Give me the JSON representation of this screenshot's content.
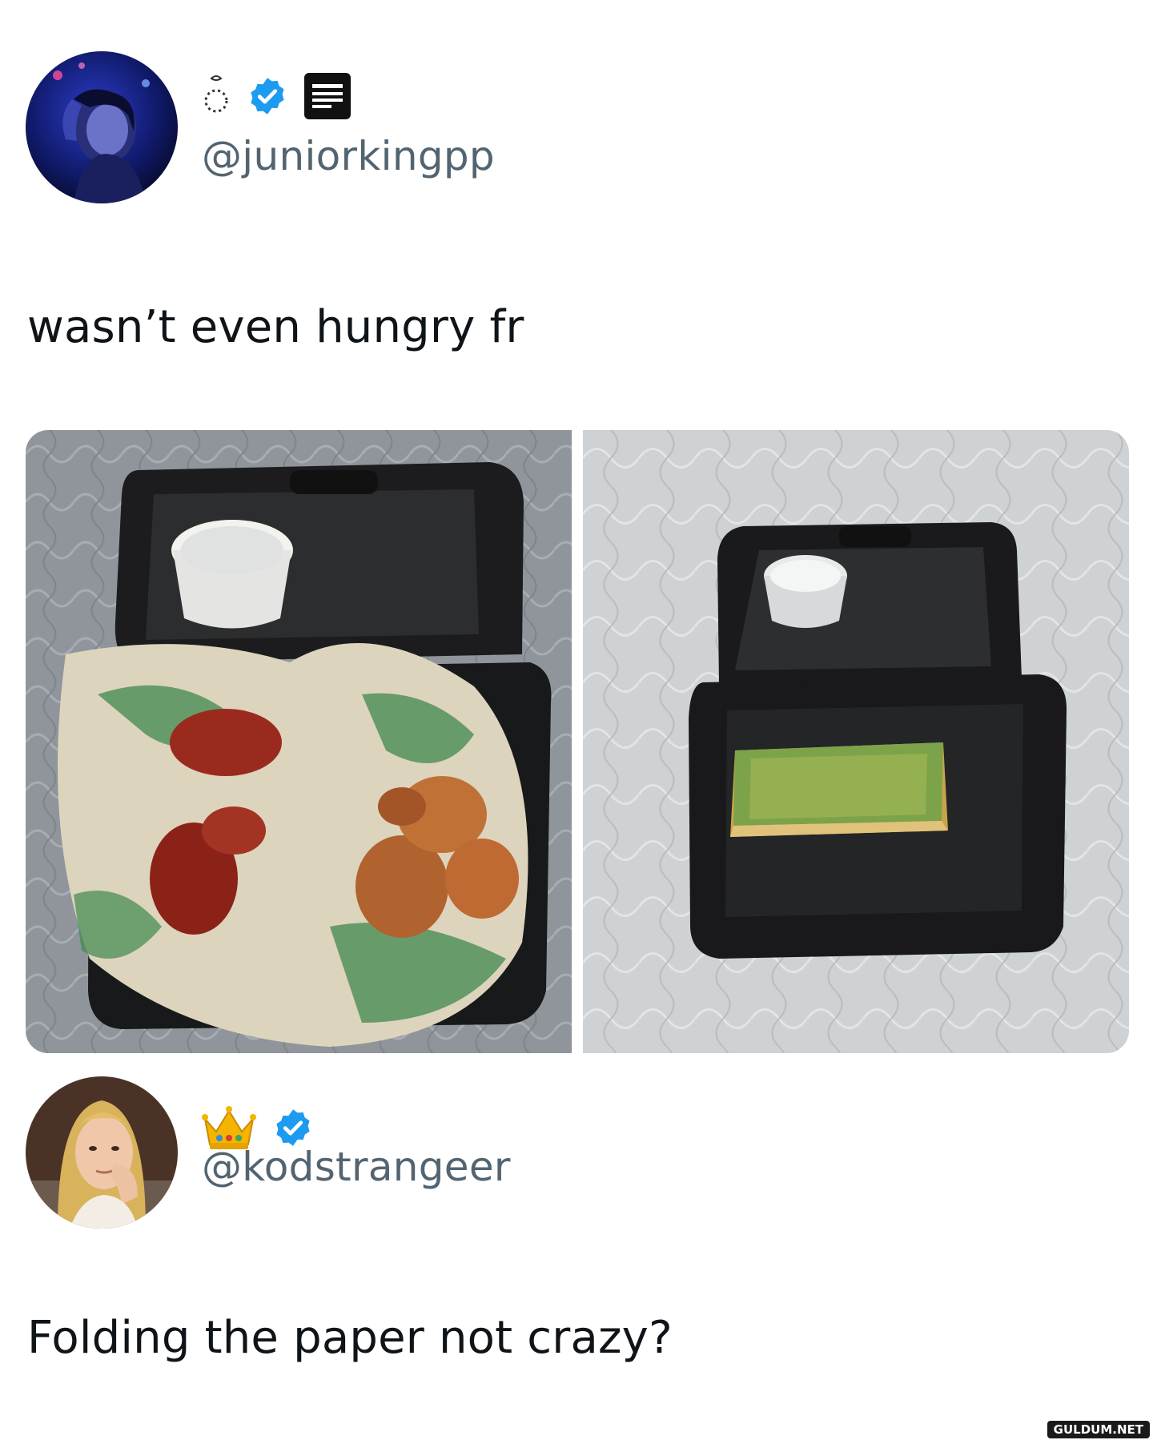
{
  "tweets": [
    {
      "handle": "@juniorkingpp",
      "text": "wasn’t even hungry fr",
      "badges": [
        "ring-emoji",
        "verified-badge",
        "newspaper-emoji"
      ],
      "media": [
        {
          "description_icon": "food-box-full-photo"
        },
        {
          "description_icon": "food-box-empty-photo"
        }
      ]
    },
    {
      "handle": "@kodstrangeer",
      "text": "Folding the paper not crazy?",
      "badges": [
        "crown-emoji",
        "verified-badge"
      ]
    }
  ],
  "watermark": "GULDUM.NET",
  "colors": {
    "verified": "#1d9bf0",
    "handle": "#536471",
    "text": "#0f1419",
    "wrapper_green": "#3f8a4f"
  }
}
